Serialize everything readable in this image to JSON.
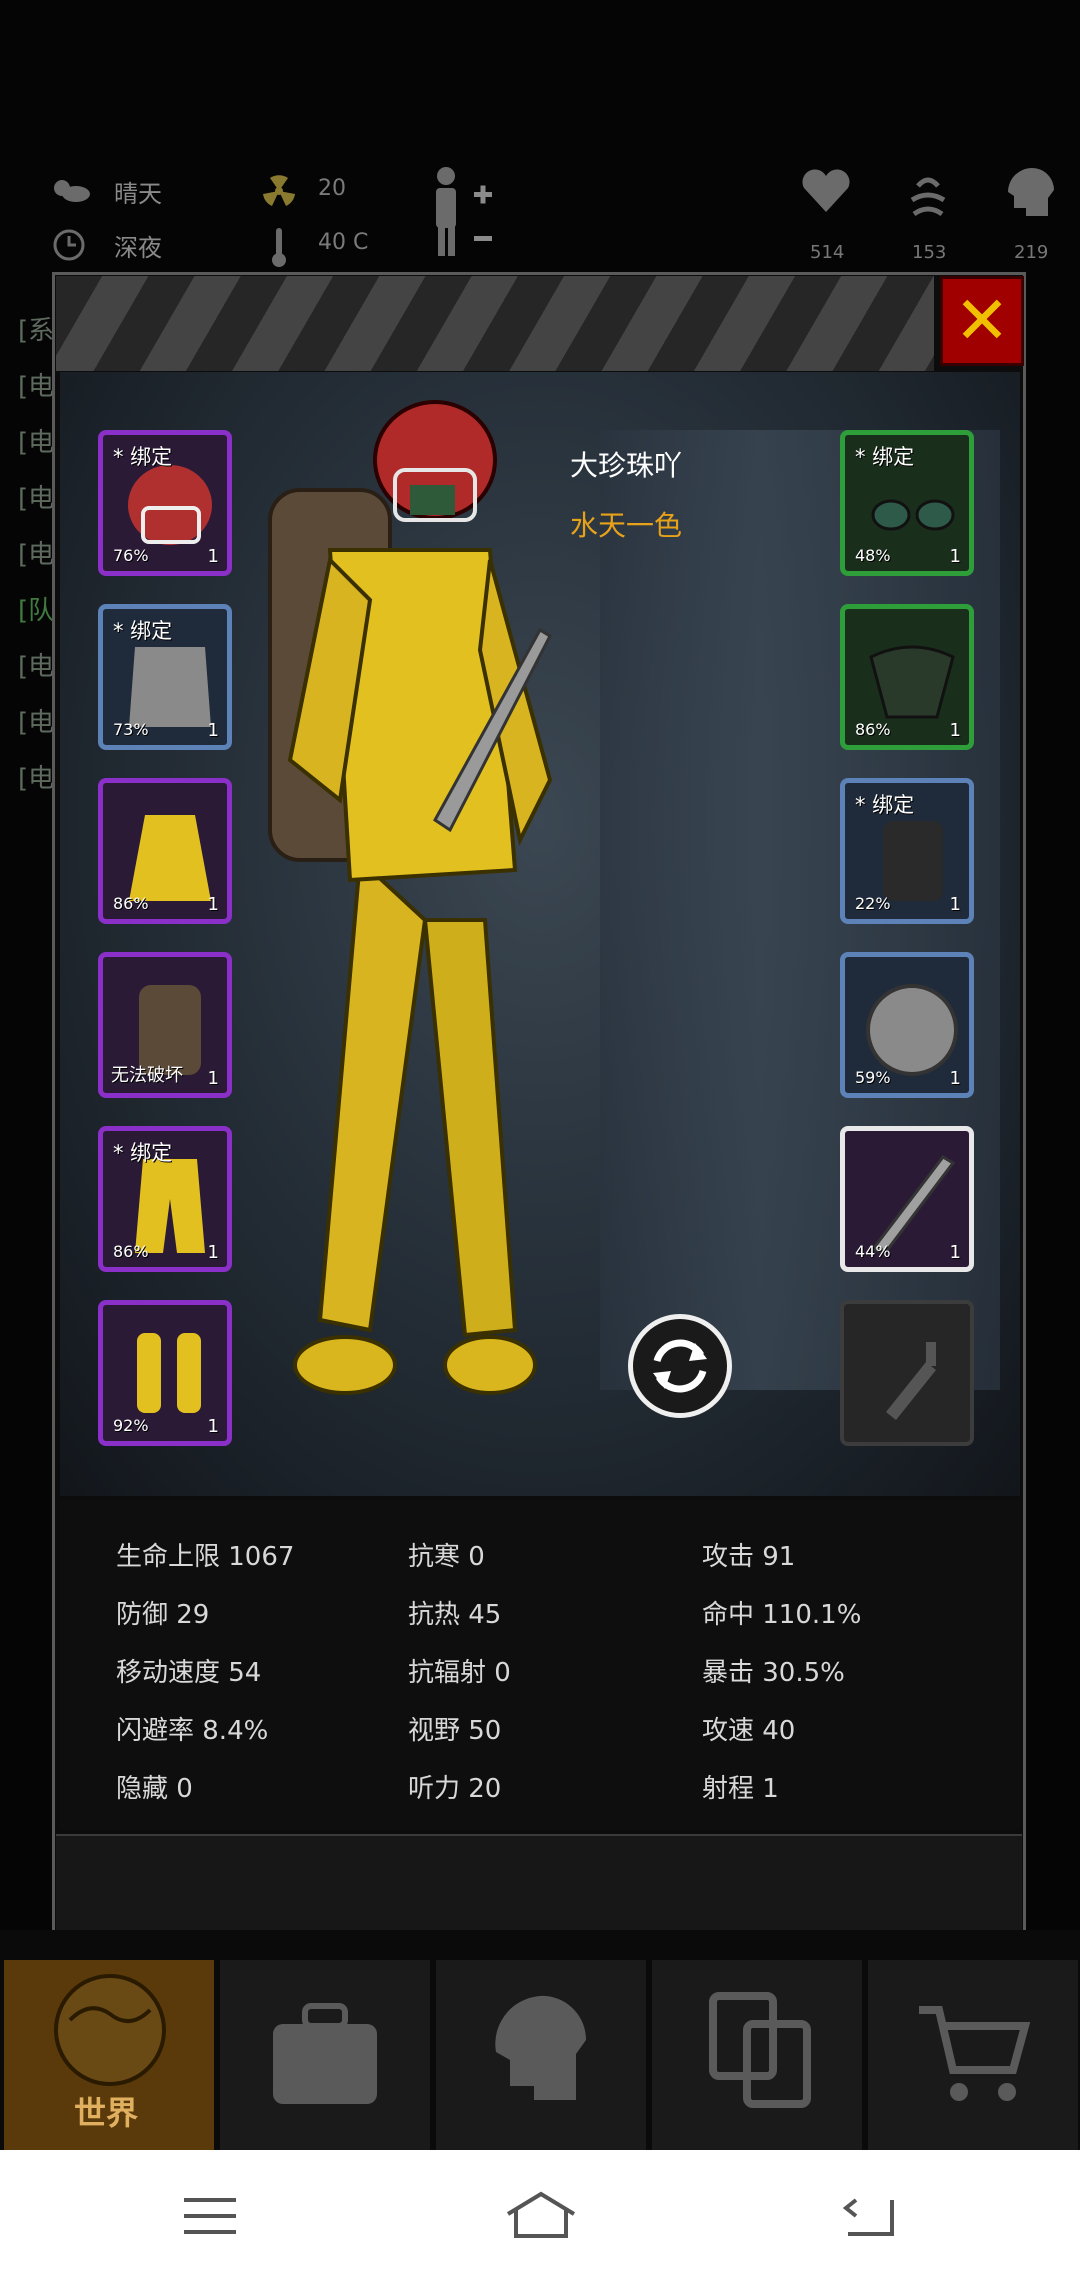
{
  "hud": {
    "weather": "晴天",
    "time": "深夜",
    "radiation": "20",
    "temperature": "40 C",
    "health": "514",
    "stamina": "153",
    "mind": "219"
  },
  "chat_lines": [
    "[系",
    "[电",
    "[电",
    "[电",
    "[电",
    "[队",
    "[电",
    "[电",
    "[电"
  ],
  "character": {
    "name": "大珍珠吖",
    "title": "水天一色"
  },
  "left_slots": [
    {
      "rarity": "purple",
      "bind": "* 绑定",
      "pct": "76%",
      "qty": "1",
      "icon": "helmet-icon"
    },
    {
      "rarity": "blue",
      "bind": "* 绑定",
      "pct": "73%",
      "qty": "1",
      "icon": "body-armor-icon"
    },
    {
      "rarity": "purple",
      "bind": "",
      "pct": "86%",
      "qty": "1",
      "icon": "jacket-icon"
    },
    {
      "rarity": "purple",
      "bind": "",
      "pct": "",
      "note": "无法破坏",
      "qty": "1",
      "icon": "backpack-icon"
    },
    {
      "rarity": "purple",
      "bind": "* 绑定",
      "pct": "86%",
      "qty": "1",
      "icon": "pants-icon"
    },
    {
      "rarity": "purple",
      "bind": "",
      "pct": "92%",
      "qty": "1",
      "icon": "boots-icon"
    }
  ],
  "right_slots": [
    {
      "rarity": "green",
      "bind": "* 绑定",
      "pct": "48%",
      "qty": "1",
      "icon": "glasses-icon"
    },
    {
      "rarity": "green",
      "bind": "",
      "pct": "86%",
      "qty": "1",
      "icon": "mask-icon"
    },
    {
      "rarity": "blue",
      "bind": "* 绑定",
      "pct": "22%",
      "qty": "1",
      "icon": "gloves-icon"
    },
    {
      "rarity": "blue",
      "bind": "",
      "pct": "59%",
      "qty": "1",
      "icon": "shield-icon"
    },
    {
      "rarity": "white",
      "bind": "",
      "pct": "44%",
      "qty": "1",
      "icon": "machete-icon"
    },
    {
      "rarity": "empty",
      "bind": "",
      "pct": "",
      "qty": "",
      "icon": "molotov-icon"
    }
  ],
  "stats": [
    [
      "生命上限 1067",
      "抗寒 0",
      "攻击 91"
    ],
    [
      "防御 29",
      "抗热 45",
      "命中 110.1%"
    ],
    [
      "移动速度 54",
      "抗辐射 0",
      "暴击 30.5%"
    ],
    [
      "闪避率 8.4%",
      "视野 50",
      "攻速 40"
    ],
    [
      "隐藏 0",
      "听力 20",
      "射程 1"
    ]
  ],
  "bottom_nav": {
    "world_label": "世界"
  },
  "colors": {
    "purple": "#8a2fc8",
    "blue": "#5c82b8",
    "green": "#2e9e3a",
    "title_gold": "#e8a21a",
    "close_red": "#a00000"
  }
}
